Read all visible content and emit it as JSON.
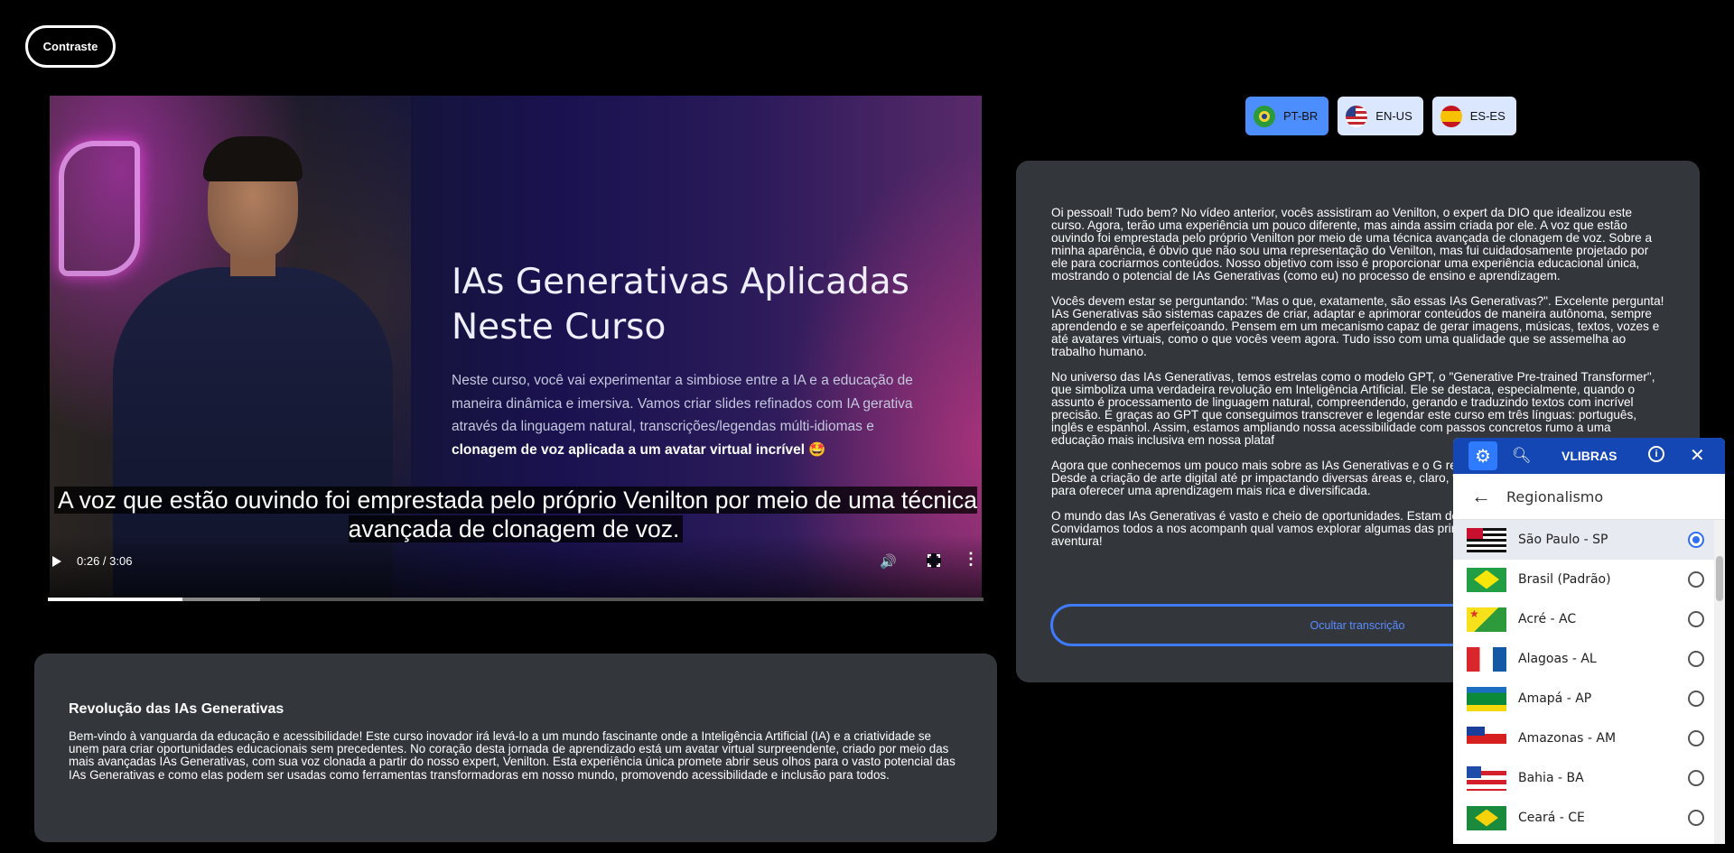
{
  "contrast_label": "Contraste",
  "video": {
    "slide_title": "IAs Generativas Aplicadas Neste Curso",
    "slide_body": "Neste curso, você vai experimentar a simbiose entre a IA e a educação de maneira dinâmica e imersiva. Vamos criar slides refinados com IA gerativa através da linguagem natural, transcrições/legendas múlti-idiomas e",
    "slide_bold": "clonagem de voz aplicada a um avatar virtual incrível 🤩",
    "caption": "A voz que estão ouvindo foi emprestada pelo próprio Venilton por meio de uma técnica avançada de clonagem de voz.",
    "time": "0:26 / 3:06",
    "progress_played": 0.144,
    "progress_buffered": 0.227
  },
  "description": {
    "title": "Revolução das IAs Generativas",
    "text": "Bem-vindo à vanguarda da educação e acessibilidade! Este curso inovador irá levá-lo a um mundo fascinante onde a Inteligência Artificial (IA) e a criatividade se unem para criar oportunidades educacionais sem precedentes. No coração desta jornada de aprendizado está um avatar virtual surpreendente, criado por meio das mais avançadas IAs Generativas, com sua voz clonada a partir do nosso expert, Venilton. Esta experiência única promete abrir seus olhos para o vasto potencial das IAs Generativas e como elas podem ser usadas como ferramentas transformadoras em nosso mundo, promovendo acessibilidade e inclusão para todos."
  },
  "languages": [
    {
      "label": "PT-BR",
      "flag": "brazil-flag-icon",
      "active": true
    },
    {
      "label": "EN-US",
      "flag": "usa-flag-icon",
      "active": false
    },
    {
      "label": "ES-ES",
      "flag": "spain-flag-icon",
      "active": false
    }
  ],
  "transcript": {
    "paragraphs": [
      "Oi pessoal! Tudo bem? No vídeo anterior, vocês assistiram ao Venilton, o expert da DIO que idealizou este curso. Agora, terão uma experiência um pouco diferente, mas ainda assim criada por ele. A voz que estão ouvindo foi emprestada pelo próprio Venilton por meio de uma técnica avançada de clonagem de voz. Sobre a minha aparência, é óbvio que não sou uma representação do Venilton, mas fui cuidadosamente projetado por ele para cocriarmos conteúdos. Nosso objetivo com isso é proporcionar uma experiência educacional única, mostrando o potencial de IAs Generativas (como eu) no processo de ensino e aprendizagem.",
      "Vocês devem estar se perguntando: \"Mas o que, exatamente, são essas IAs Generativas?\". Excelente pergunta! IAs Generativas são sistemas capazes de criar, adaptar e aprimorar conteúdos de maneira autônoma, sempre aprendendo e se aperfeiçoando. Pensem em um mecanismo capaz de gerar imagens, músicas, textos, vozes e até avatares virtuais, como o que vocês veem agora. Tudo isso com uma qualidade que se assemelha ao trabalho humano.",
      "No universo das IAs Generativas, temos estrelas como o modelo GPT, o \"Generative Pre-trained Transformer\", que simboliza uma verdadeira revolução em Inteligência Artificial. Ele se destaca, especialmente, quando o assunto é processamento de linguagem natural, compreendendo, gerando e traduzindo textos com incrível precisão. É graças ao GPT que conseguimos transcrever e legendar este curso em três línguas: português, inglês e espanhol. Assim, estamos ampliando nossa acessibilidade com passos concretos rumo a uma educação mais inclusiva em nossa plataf",
      "Agora que conhecemos um pouco mais sobre as IAs Generativas e o G revolucionando diferentes setores. Desde a criação de arte digital até pr impactando diversas áreas e, claro, também a educação. Aqui na DIO, e para oferecer uma aprendizagem mais rica e diversificada.",
      "O mundo das IAs Generativas é vasto e cheio de oportunidades. Estam descoberta de seu amplo potencial. Convidamos todos a nos acompanh qual vamos explorar algumas das principais aplicações práticas das IAs aventura!"
    ],
    "hide_label": "Ocultar transcrição"
  },
  "vlibras": {
    "title": "VLIBRAS",
    "subtitle": "Regionalismo",
    "items": [
      {
        "name": "São Paulo - SP",
        "flag": "f-sp",
        "selected": true
      },
      {
        "name": "Brasil (Padrão)",
        "flag": "f-br",
        "selected": false
      },
      {
        "name": "Acré - AC",
        "flag": "f-ac",
        "selected": false
      },
      {
        "name": "Alagoas - AL",
        "flag": "f-al",
        "selected": false
      },
      {
        "name": "Amapá - AP",
        "flag": "f-ap",
        "selected": false
      },
      {
        "name": "Amazonas - AM",
        "flag": "f-am",
        "selected": false
      },
      {
        "name": "Bahia - BA",
        "flag": "f-ba",
        "selected": false
      },
      {
        "name": "Ceará - CE",
        "flag": "f-ce",
        "selected": false
      }
    ]
  }
}
